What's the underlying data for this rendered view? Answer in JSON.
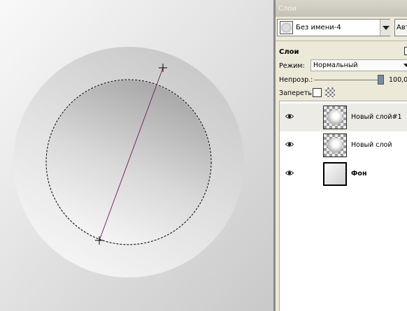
{
  "panel": {
    "title": "Слои",
    "image_selector": {
      "name": "Без имени-4"
    },
    "auto_button": {
      "label": "Авто"
    },
    "layers_header": "Слои",
    "mode": {
      "label": "Режим:",
      "value": "Нормальный"
    },
    "opacity": {
      "label": "Непрозр.:",
      "value": "100,0"
    },
    "lock": {
      "label": "Запереть:"
    },
    "layers": [
      {
        "name": "Новый слой#1",
        "selected": true,
        "bold": false
      },
      {
        "name": "Новый слой",
        "selected": false,
        "bold": false
      },
      {
        "name": "Фон",
        "selected": false,
        "bold": true
      }
    ]
  },
  "colors": {
    "selection": "#000000",
    "guide_line": "#7a2a5e"
  },
  "icons": [
    "eye-icon",
    "chevron-down-icon",
    "lock-pixels-icon",
    "lock-alpha-icon"
  ]
}
